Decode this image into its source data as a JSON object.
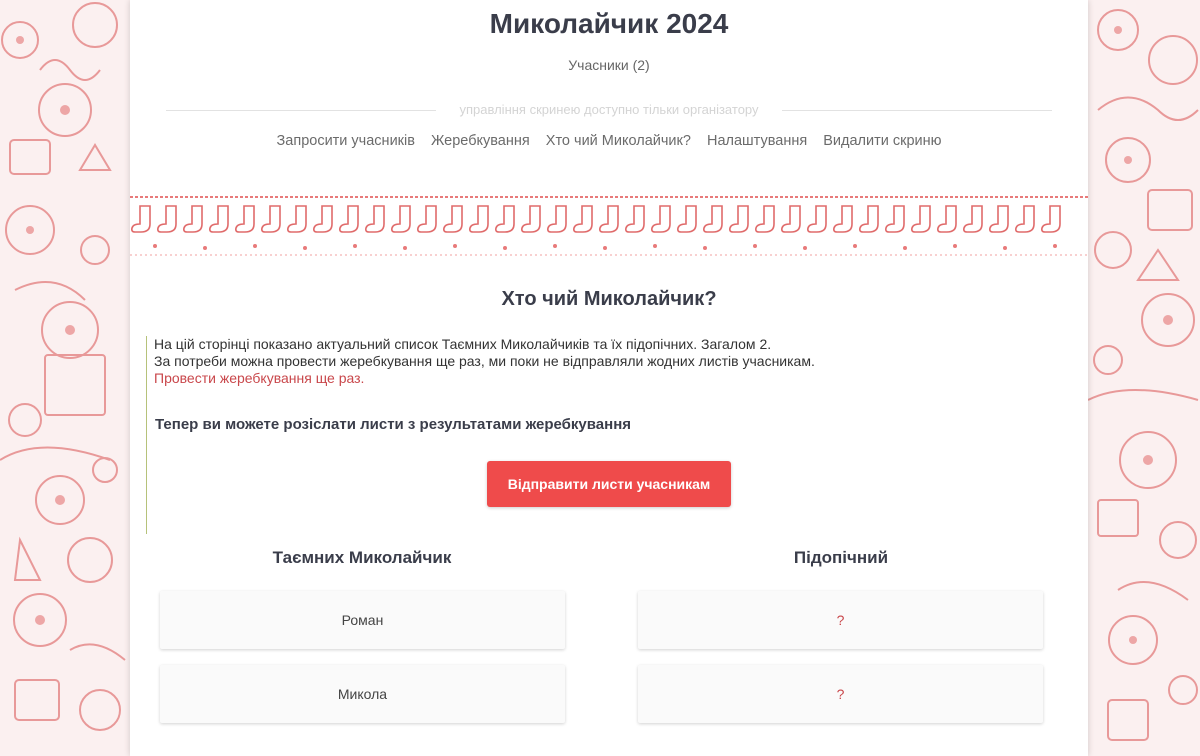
{
  "header": {
    "title": "Миколайчик 2024",
    "participants": "Учасники (2)",
    "organizer_note": "управління скринею доступно тільки організатору"
  },
  "nav": [
    {
      "label": "Запросити учасників"
    },
    {
      "label": "Жеребкування"
    },
    {
      "label": "Хто чий Миколайчик?"
    },
    {
      "label": "Налаштування"
    },
    {
      "label": "Видалити скриню"
    }
  ],
  "section": {
    "title": "Хто чий Миколайчик?",
    "line1": "На цій сторінці показано актуальний список Таємних Миколайчиків та їх підопічних. Загалом 2.",
    "line2": "За потреби можна провести жеребкування ще раз, ми поки не відправляли жодних листів учасникам.",
    "redo_link": "Провести жеребкування ще раз.",
    "subhead": "Тепер ви можете розіслати листи з результатами жеребкування",
    "send_button": "Відправити листи учасникам"
  },
  "table": {
    "col1": "Таємних Миколайчик",
    "col2": "Підопічний",
    "rows": [
      {
        "santa": "Роман",
        "ward": "?"
      },
      {
        "santa": "Микола",
        "ward": "?"
      }
    ]
  },
  "colors": {
    "accent_red": "#ef4b4b",
    "link_red": "#c9474b",
    "pattern": "#e06b6b"
  }
}
